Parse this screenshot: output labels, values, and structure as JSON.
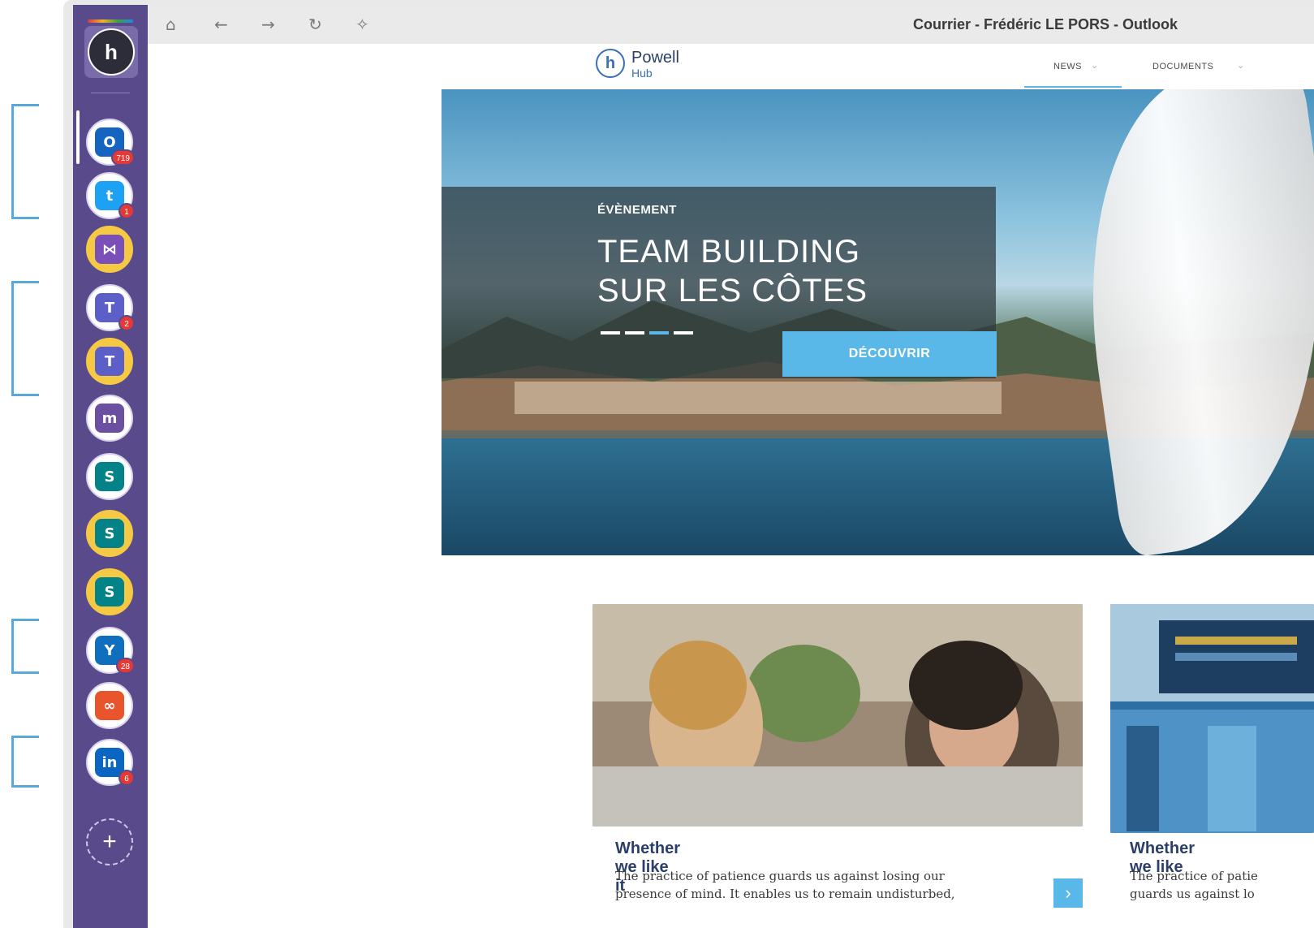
{
  "window": {
    "title": "Courrier - Frédéric LE PORS - Outlook"
  },
  "nav": {
    "home_icon": "home-icon",
    "back_icon": "arrow-left-icon",
    "forward_icon": "arrow-right-icon",
    "reload_icon": "reload-icon",
    "pin_icon": "pin-icon"
  },
  "sidebar": {
    "logo_letter": "h",
    "apps": [
      {
        "name": "outlook",
        "glyph": "O",
        "color": "#1565c0",
        "badge": "719"
      },
      {
        "name": "twitter",
        "glyph": "t",
        "color": "#1da1f2",
        "badge": "1"
      },
      {
        "name": "visual-studio",
        "glyph": "⋈",
        "color": "#7b4fb8",
        "badge": ""
      },
      {
        "name": "teams",
        "glyph": "T",
        "color": "#5b5fc7",
        "badge": "2"
      },
      {
        "name": "teams-2",
        "glyph": "T",
        "color": "#5b5fc7",
        "badge": ""
      },
      {
        "name": "mi",
        "glyph": "m",
        "color": "#6b4fa0",
        "badge": ""
      },
      {
        "name": "sharepoint",
        "glyph": "S",
        "color": "#038387",
        "badge": ""
      },
      {
        "name": "sharepoint-2",
        "glyph": "S",
        "color": "#038387",
        "badge": ""
      },
      {
        "name": "sharepoint-3",
        "glyph": "S",
        "color": "#038387",
        "badge": ""
      },
      {
        "name": "yammer",
        "glyph": "Y",
        "color": "#106ebe",
        "badge": "28"
      },
      {
        "name": "link",
        "glyph": "∞",
        "color": "#e8542c",
        "badge": ""
      },
      {
        "name": "linkedin",
        "glyph": "in",
        "color": "#0a66c2",
        "badge": "6"
      }
    ],
    "add_label": "+"
  },
  "site": {
    "logo_letter": "h",
    "logo_line1": "Powell",
    "logo_line2": "Hub",
    "menu": [
      {
        "label": "NEWS"
      },
      {
        "label": "DOCUMENTS"
      }
    ]
  },
  "hero": {
    "kicker": "ÉVÈNEMENT",
    "title_line1": "TEAM BUILDING",
    "title_line2": "SUR LES CÔTES",
    "cta": "DÉCOUVRIR",
    "slides": 4,
    "active_slide": 3
  },
  "news": [
    {
      "title": "Whether we like it",
      "line1": "The practice of patience guards us against losing our",
      "line2": "presence of mind. It enables us to remain undisturbed,"
    },
    {
      "title": "Whether we like",
      "line1": "The practice of patie",
      "line2": "guards us against lo"
    }
  ],
  "colors": {
    "sidebar": "#594a8c",
    "accent": "#5ab8e8",
    "brand": "#2b3f6a"
  }
}
